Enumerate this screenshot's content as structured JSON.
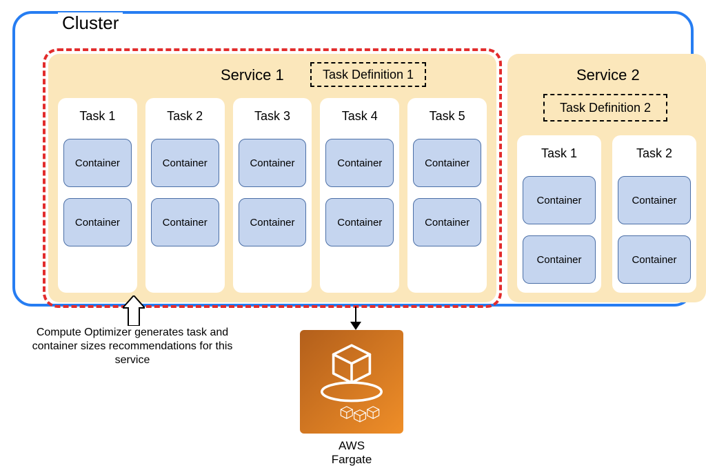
{
  "cluster": {
    "label": "Cluster"
  },
  "service1": {
    "title": "Service 1",
    "task_definition_label": "Task Definition 1",
    "tasks": [
      {
        "label": "Task 1",
        "containers": [
          "Container",
          "Container"
        ]
      },
      {
        "label": "Task 2",
        "containers": [
          "Container",
          "Container"
        ]
      },
      {
        "label": "Task 3",
        "containers": [
          "Container",
          "Container"
        ]
      },
      {
        "label": "Task 4",
        "containers": [
          "Container",
          "Container"
        ]
      },
      {
        "label": "Task 5",
        "containers": [
          "Container",
          "Container"
        ]
      }
    ]
  },
  "service2": {
    "title": "Service 2",
    "task_definition_label": "Task Definition 2",
    "tasks": [
      {
        "label": "Task 1",
        "containers": [
          "Container",
          "Container"
        ]
      },
      {
        "label": "Task 2",
        "containers": [
          "Container",
          "Container"
        ]
      }
    ]
  },
  "callout_text": "Compute Optimizer generates task and container sizes recommendations for this service",
  "fargate": {
    "title": "AWS",
    "subtitle": "Fargate"
  }
}
